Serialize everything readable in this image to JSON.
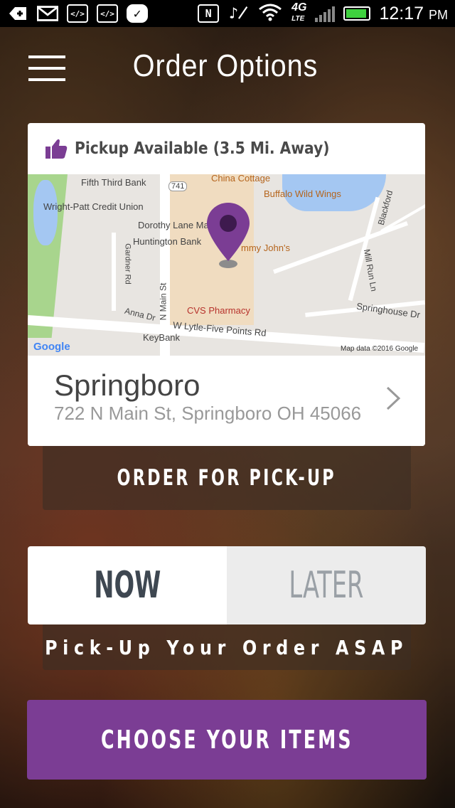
{
  "status_bar": {
    "time": "12:17",
    "ampm": "PM",
    "network": "4G",
    "network_sub": "LTE",
    "icons": [
      "add-icon",
      "gmail-icon",
      "code-icon",
      "code-icon",
      "check-app-icon",
      "nfc-icon",
      "mute-icon",
      "wifi-icon",
      "signal-icon",
      "battery-icon"
    ]
  },
  "header": {
    "title": "Order Options"
  },
  "location_card": {
    "availability": "Pickup Available (3.5 Mi. Away)",
    "store_name": "Springboro",
    "address": "722 N Main St, Springboro OH 45066",
    "accent_color": "#7b3d94"
  },
  "map": {
    "labels": {
      "fifth_third": "Fifth Third Bank",
      "route": "741",
      "china_cottage": "China Cottage",
      "buffalo": "Buffalo Wild Wings",
      "wright_patt": "Wright-Patt Credit Union",
      "dorothy": "Dorothy Lane Ma",
      "huntington": "Huntington Bank",
      "jimmy": "mmy John's",
      "gardner": "Gardner Rd",
      "n_main": "N Main St",
      "cvs": "CVS Pharmacy",
      "anna": "Anna Dr",
      "lytle": "W Lytle-Five Points Rd",
      "keybank": "KeyBank",
      "blackford": "Blackford",
      "mill_run": "Mill Run Ln",
      "springhouse": "Springhouse Dr",
      "google": "Google",
      "attribution": "Map data ©2016 Google"
    }
  },
  "order_type": {
    "label": "ORDER FOR PICK-UP"
  },
  "timing": {
    "now": "NOW",
    "later": "LATER",
    "selected": "NOW",
    "note": "Pick-Up Your Order ASAP"
  },
  "cta": {
    "label": "CHOOSE YOUR ITEMS",
    "color": "#7b3d94"
  }
}
